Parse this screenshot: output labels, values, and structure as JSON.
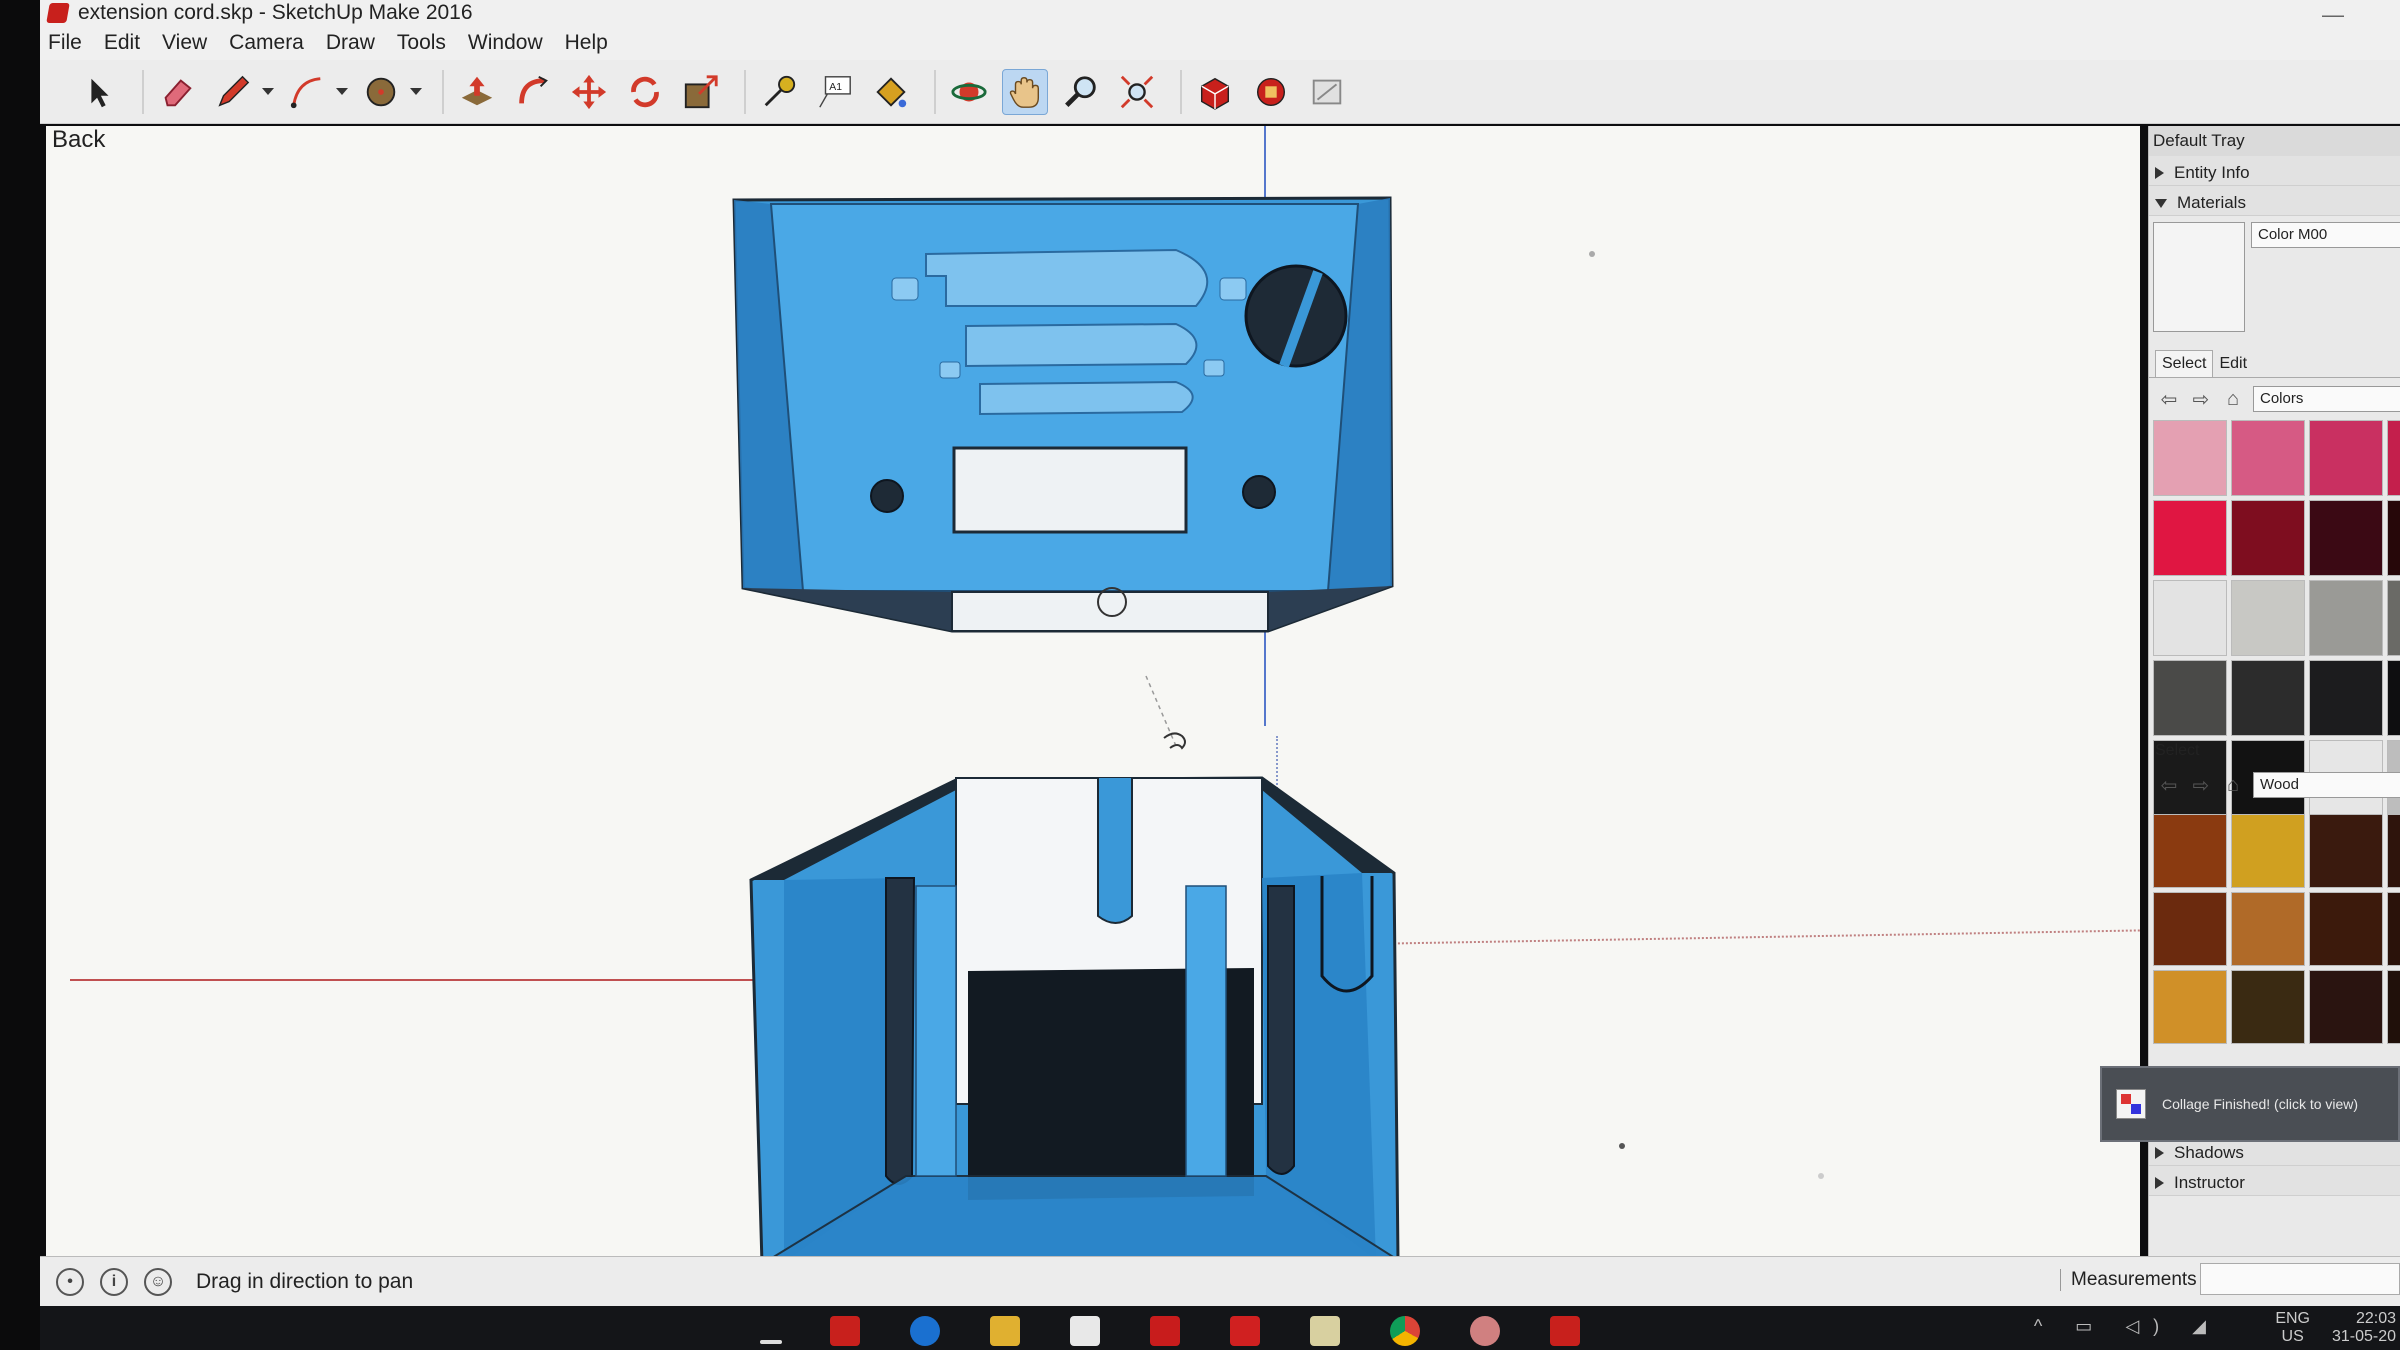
{
  "app": {
    "window_title": "extension cord.skp - SketchUp Make 2016",
    "minimize_glyph": "—"
  },
  "menu": [
    "File",
    "Edit",
    "View",
    "Camera",
    "Draw",
    "Tools",
    "Window",
    "Help"
  ],
  "toolbar": {
    "tools": [
      "select-tool",
      "eraser-tool",
      "pencil-tool",
      "arc-tool",
      "circle-tool",
      "push-pull-tool",
      "follow-me-tool",
      "move-tool",
      "rotate-tool",
      "scale-tool",
      "tape-measure-tool",
      "text-tool",
      "paint-bucket-tool",
      "orbit-tool",
      "pan-tool",
      "zoom-tool",
      "zoom-extents-tool",
      "warehouse-tool",
      "extension-tool",
      "layout-tool"
    ],
    "active_tool": "pan-tool"
  },
  "viewport": {
    "view_label": "Back"
  },
  "tray": {
    "title": "Default Tray",
    "panels": {
      "entity_info": "Entity Info",
      "materials": "Materials",
      "shadows": "Shadows",
      "instructor": "Instructor"
    },
    "material_name": "Color M00",
    "tabs": [
      "Select",
      "Edit"
    ],
    "library_top": "Colors",
    "library_bottom": "Wood",
    "select_label": "Select",
    "color_swatches": [
      "#e4a0b2",
      "#d65a84",
      "#c93061",
      "#c41f4c",
      "#e01642",
      "#7e0d1f",
      "#3b0914",
      "#260709",
      "#e3e3e3",
      "#c8c8c4",
      "#9a9a96",
      "#6a6a66",
      "#4a4a48",
      "#2c2c2c",
      "#1c1c1e",
      "#0e0e10",
      "#1a1a1a",
      "#121212",
      "#e6e6e6",
      "#bdbdbd"
    ],
    "wood_swatches": [
      "#8a3a10",
      "#d0a020",
      "#3a1a0e",
      "#2e140c",
      "#6b2a0e",
      "#b06a28",
      "#3c1a0c",
      "#2a120a",
      "#d09028",
      "#3a2a12",
      "#2a1410",
      "#20100a"
    ]
  },
  "toast": {
    "text": "Collage Finished! (click to view)"
  },
  "status": {
    "hint": "Drag in direction to pan",
    "measurements_label": "Measurements"
  },
  "taskbar": {
    "lang_line1": "ENG",
    "lang_line2": "US",
    "time": "22:03",
    "date": "31-05-20"
  },
  "colors": {
    "model_blue": "#3a98d8",
    "model_dark": "#1c2a36",
    "accent_red": "#c8201c"
  }
}
